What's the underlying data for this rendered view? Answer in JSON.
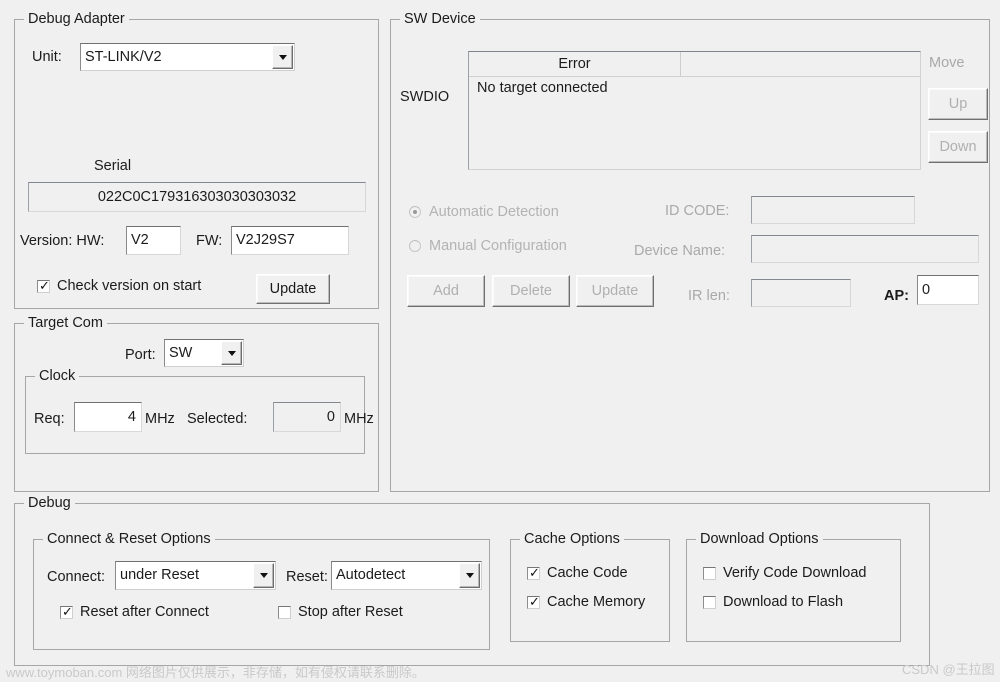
{
  "debug_adapter": {
    "legend": "Debug Adapter",
    "unit_label": "Unit:",
    "unit_value": "ST-LINK/V2",
    "serial_label": "Serial",
    "serial_value": "022C0C179316303030303032",
    "version_label": "Version: HW:",
    "hw_value": "V2",
    "fw_label": "FW:",
    "fw_value": "V2J29S7",
    "check_version_label": "Check version on start",
    "check_version_checked": true,
    "update_label": "Update"
  },
  "sw_device": {
    "legend": "SW Device",
    "swdio_label": "SWDIO",
    "columns": [
      "Error",
      ""
    ],
    "rows": [
      [
        "No target connected",
        ""
      ]
    ],
    "move_label": "Move",
    "up_label": "Up",
    "down_label": "Down",
    "automatic_detection_label": "Automatic Detection",
    "automatic_detection_selected": true,
    "manual_configuration_label": "Manual Configuration",
    "manual_configuration_selected": false,
    "id_code_label": "ID CODE:",
    "id_code_value": "",
    "device_name_label": "Device Name:",
    "device_name_value": "",
    "ir_len_label": "IR len:",
    "ir_len_value": "",
    "ap_label": "AP:",
    "ap_value": "0",
    "add_label": "Add",
    "delete_label": "Delete",
    "update_label": "Update"
  },
  "target_com": {
    "legend": "Target Com",
    "port_label": "Port:",
    "port_value": "SW",
    "clock_legend": "Clock",
    "req_label": "Req:",
    "req_value": "4",
    "req_unit": "MHz",
    "selected_label": "Selected:",
    "selected_value": "0",
    "selected_unit": "MHz"
  },
  "debug": {
    "legend": "Debug",
    "connect_reset": {
      "legend": "Connect & Reset Options",
      "connect_label": "Connect:",
      "connect_value": "under Reset",
      "reset_label": "Reset:",
      "reset_value": "Autodetect",
      "reset_after_connect_label": "Reset after Connect",
      "reset_after_connect_checked": true,
      "stop_after_reset_label": "Stop after Reset",
      "stop_after_reset_checked": false
    },
    "cache_options": {
      "legend": "Cache Options",
      "cache_code_label": "Cache Code",
      "cache_code_checked": true,
      "cache_memory_label": "Cache Memory",
      "cache_memory_checked": true
    },
    "download_options": {
      "legend": "Download Options",
      "verify_code_download_label": "Verify Code Download",
      "verify_code_download_checked": false,
      "download_to_flash_label": "Download to Flash",
      "download_to_flash_checked": false
    }
  },
  "watermarks": {
    "left": "www.toymoban.com 网络图片仅供展示，非存储，如有侵权请联系删除。",
    "right": "CSDN @王拉图"
  },
  "colors": {
    "background": "#f0f0f0",
    "border": "#a6a6a6",
    "text": "#1b1b1b",
    "disabled_text": "#b0b0b0"
  }
}
